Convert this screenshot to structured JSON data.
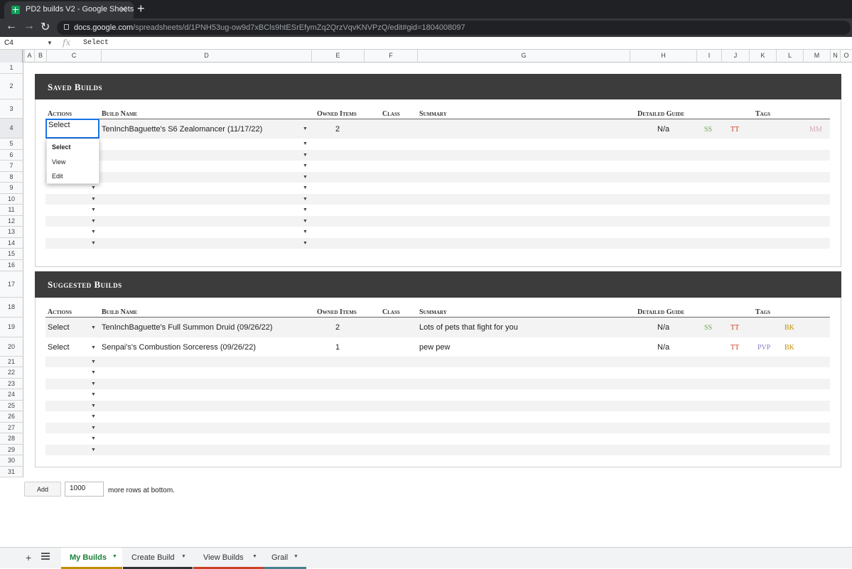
{
  "browser": {
    "tab_title": "PD2 builds V2 - Google Sheets",
    "url_host": "docs.google.com",
    "url_path": "/spreadsheets/d/1PNH53ug-ow9d7xBCls9htESrEfymZq2QrzVqvKNVPzQ/edit#gid=1804008097"
  },
  "formula_bar": {
    "cell_ref": "C4",
    "fx": "fx",
    "value": "Select"
  },
  "columns": [
    "A",
    "B",
    "C",
    "D",
    "E",
    "F",
    "G",
    "H",
    "I",
    "J",
    "K",
    "L",
    "M",
    "N",
    "O"
  ],
  "rows": [
    "1",
    "2",
    "3",
    "4",
    "5",
    "6",
    "7",
    "8",
    "9",
    "10",
    "11",
    "12",
    "13",
    "14",
    "15",
    "16",
    "17",
    "18",
    "19",
    "20",
    "21",
    "22",
    "23",
    "24",
    "25",
    "26",
    "27",
    "28",
    "29",
    "30",
    "31"
  ],
  "column_headers": {
    "actions": "Actions",
    "build_name": "Build Name",
    "owned_items": "Owned Items",
    "class": "Class",
    "summary": "Summary",
    "detailed_guide": "Detailed Guide",
    "tags": "Tags"
  },
  "saved_builds": {
    "title": "Saved Builds",
    "rows": [
      {
        "action": "Select",
        "build_name": "TenInchBaguette's S6 Zealomancer (11/17/22)",
        "owned_items": "2",
        "summary": "",
        "guide": "N/a",
        "tags": [
          "SS",
          "TT",
          "MM"
        ]
      }
    ]
  },
  "dropdown_menu": [
    "Select",
    "View",
    "Edit"
  ],
  "suggested_builds": {
    "title": "Suggested Builds",
    "rows": [
      {
        "action": "Select",
        "build_name": "TenInchBaguette's Full Summon Druid (09/26/22)",
        "owned_items": "2",
        "summary": "Lots of pets that fight for you",
        "guide": "N/a",
        "tags": [
          "SS",
          "TT",
          "BK"
        ]
      },
      {
        "action": "Select",
        "build_name": "Senpai's's Combustion Sorceress (09/26/22)",
        "owned_items": "1",
        "summary": "pew pew",
        "guide": "N/a",
        "tags": [
          "TT",
          "PVP",
          "BK"
        ]
      }
    ]
  },
  "tag_colors": {
    "SS": "#6aa84f",
    "TT": "#cc4125",
    "MM": "#d5a6bd",
    "BK": "#bf9000",
    "PVP": "#8e7cc3"
  },
  "footer": {
    "add_label": "Add",
    "add_count": "1000",
    "add_text": "more rows at bottom."
  },
  "sheet_tabs": [
    {
      "label": "My Builds",
      "color": "#bf9000",
      "active": true
    },
    {
      "label": "Create Build",
      "color": "#333333",
      "active": false
    },
    {
      "label": "View Builds",
      "color": "#cc4125",
      "active": false
    },
    {
      "label": "Grail",
      "color": "#45818e",
      "active": false
    }
  ]
}
